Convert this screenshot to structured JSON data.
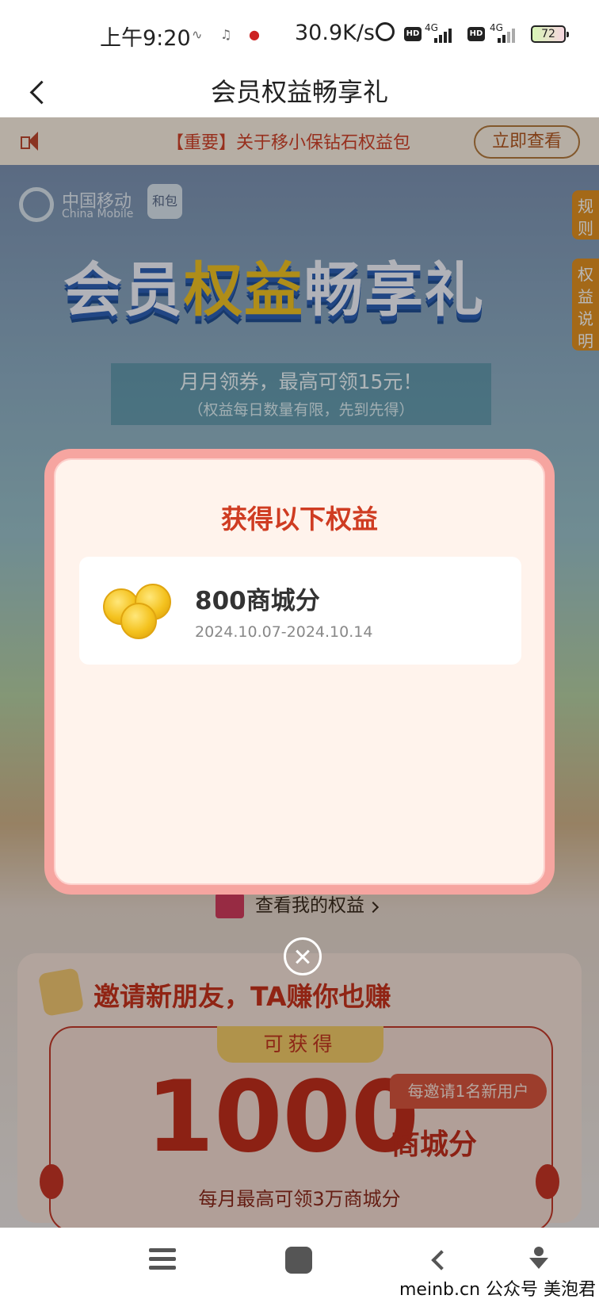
{
  "status_bar": {
    "time": "上午9:20",
    "net_speed": "30.9K/s",
    "net1": "4G",
    "net2": "4G",
    "hd": "HD",
    "battery": "72"
  },
  "header": {
    "title": "会员权益畅享礼"
  },
  "notice": {
    "text": "【重要】关于移小保钻石权益包",
    "button_label": "立即查看"
  },
  "banner": {
    "brand_cn": "中国移动",
    "brand_en": "China Mobile",
    "hebao": "和包",
    "title_part1": "会员",
    "title_part2": "权益",
    "title_part3": "畅享礼",
    "subtitle": "月月领券，最高可领15元！",
    "note": "（权益每日数量有限，先到先得）",
    "side_rules": "规则",
    "side_desc": "权益说明"
  },
  "modal": {
    "title": "获得以下权益",
    "benefit_name": "800商城分",
    "benefit_dates": "2024.10.07-2024.10.14"
  },
  "page": {
    "my_rights_link": "查看我的权益",
    "invite_title": "邀请新朋友，TA赚你也赚",
    "obtain_label": "可获得",
    "points_value": "1000",
    "per_invite": "每邀请1名新用户",
    "points_unit": "商城分",
    "monthly_max": "每月最高可领3万商城分"
  },
  "watermark": "meinb.cn  公众号 美泡君"
}
